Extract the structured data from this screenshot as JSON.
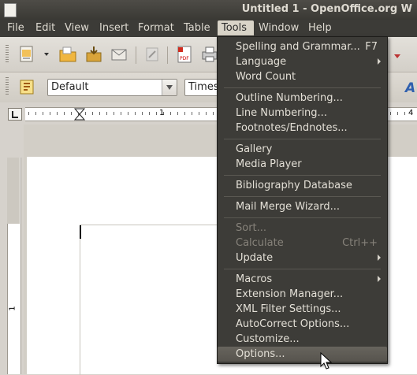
{
  "window": {
    "title": "Untitled 1 - OpenOffice.org W"
  },
  "menubar": {
    "items": [
      {
        "label": "File"
      },
      {
        "label": "Edit"
      },
      {
        "label": "View"
      },
      {
        "label": "Insert"
      },
      {
        "label": "Format"
      },
      {
        "label": "Table"
      },
      {
        "label": "Tools"
      },
      {
        "label": "Window"
      },
      {
        "label": "Help"
      }
    ]
  },
  "formatting": {
    "style": "Default",
    "font": "Times"
  },
  "ruler": {
    "mark_1": "1",
    "mark_4": "4",
    "vmark_1": "1"
  },
  "tools_menu": {
    "items": [
      {
        "label": "Spelling and Grammar...",
        "accel": "F7"
      },
      {
        "label": "Language",
        "submenu": true
      },
      {
        "label": "Word Count"
      },
      {
        "label": "Outline Numbering..."
      },
      {
        "label": "Line Numbering..."
      },
      {
        "label": "Footnotes/Endnotes..."
      },
      {
        "label": "Gallery"
      },
      {
        "label": "Media Player"
      },
      {
        "label": "Bibliography Database"
      },
      {
        "label": "Mail Merge Wizard..."
      },
      {
        "label": "Sort...",
        "disabled": true
      },
      {
        "label": "Calculate",
        "accel": "Ctrl++",
        "disabled": true
      },
      {
        "label": "Update",
        "submenu": true
      },
      {
        "label": "Macros",
        "submenu": true
      },
      {
        "label": "Extension Manager..."
      },
      {
        "label": "XML Filter Settings..."
      },
      {
        "label": "AutoCorrect Options..."
      },
      {
        "label": "Customize..."
      },
      {
        "label": "Options...",
        "highlighted": true
      }
    ]
  },
  "colors": {
    "menu_bg": "#3d3c38",
    "menu_text": "#e3dfd6",
    "highlight": "#5f5c55"
  },
  "icons": [
    "new-document-icon",
    "open-folder-icon",
    "save-icon",
    "email-icon",
    "edit-file-icon",
    "export-pdf-icon",
    "print-icon",
    "styles-icon",
    "mouse-pointer-icon"
  ]
}
